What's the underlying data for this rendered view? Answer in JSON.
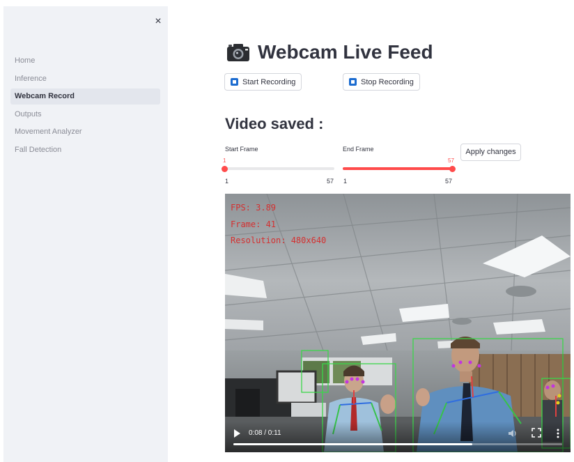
{
  "sidebar": {
    "close_glyph": "×",
    "items": [
      {
        "label": "Home",
        "active": false
      },
      {
        "label": "Inference",
        "active": false
      },
      {
        "label": "Webcam Record",
        "active": true
      },
      {
        "label": "Outputs",
        "active": false
      },
      {
        "label": "Movement Analyzer",
        "active": false
      },
      {
        "label": "Fall Detection",
        "active": false
      }
    ]
  },
  "main": {
    "title": "Webcam Live Feed",
    "title_icon": "camera-icon",
    "start_button": "Start Recording",
    "stop_button": "Stop Recording",
    "subtitle": "Video saved :",
    "start_frame": {
      "label": "Start Frame",
      "value": "1",
      "min": "1",
      "max": "57"
    },
    "end_frame": {
      "label": "End Frame",
      "value": "57",
      "min": "1",
      "max": "57"
    },
    "apply_button": "Apply changes"
  },
  "video": {
    "fps_text": "FPS: 3.89",
    "frame_text": "Frame: 41",
    "resolution_text": "Resolution: 480x640",
    "time": "0:08 / 0:11",
    "progress": 0.727,
    "colors": {
      "accent": "#ff4b4b",
      "overlay_text": "#d43030",
      "button_icon": "#1c6cd0"
    }
  }
}
